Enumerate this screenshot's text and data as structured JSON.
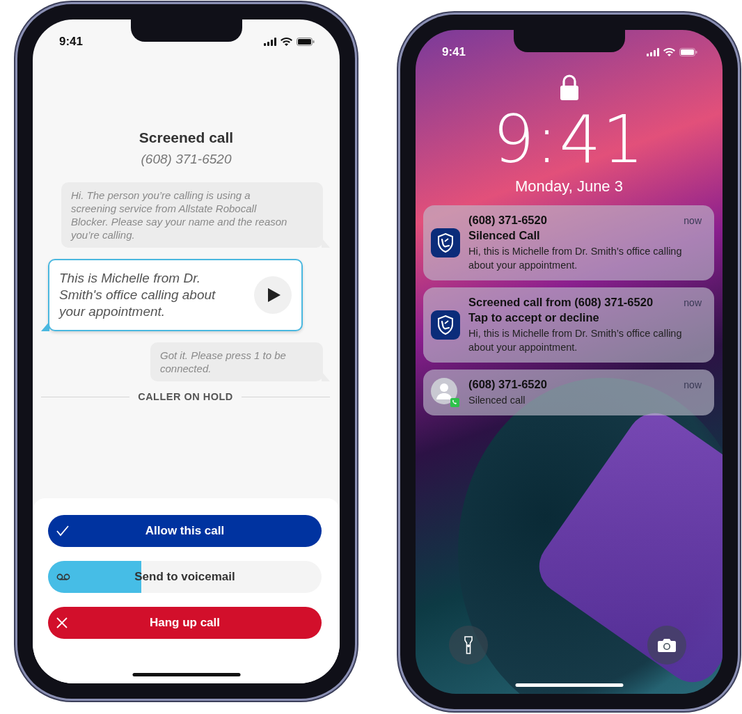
{
  "call_screen": {
    "status_bar": {
      "time": "9:41"
    },
    "title": "Screened call",
    "number": "(608) 371-6520",
    "messages": [
      {
        "kind": "prompt",
        "text": "Hi. The person you’re calling is using a screening service from Allstate Robocall Blocker. Please say your name and the reason you’re calling."
      },
      {
        "kind": "caller",
        "text": "This is Michelle from Dr. Smith's office calling about your appointment."
      },
      {
        "kind": "prompt",
        "text": "Got it. Please press 1 to be connected."
      }
    ],
    "hold_label": "CALLER ON HOLD",
    "actions": [
      {
        "kind": "allow",
        "label": "Allow this call"
      },
      {
        "kind": "voicemail",
        "label": "Send to voicemail",
        "level": 0.34
      },
      {
        "kind": "hangup",
        "label": "Hang up call"
      }
    ]
  },
  "lock_screen": {
    "status_bar": {
      "time": "9:41"
    },
    "clock": "9:41",
    "date": "Monday, June 3",
    "notifications": [
      {
        "kind": "app",
        "title": "(608) 371-6520",
        "subtitle": "Silenced Call",
        "body": "Hi, this is Michelle from Dr. Smith’s office calling about your appointment.",
        "time": "now"
      },
      {
        "kind": "app",
        "title": "Screened call from (608) 371-6520",
        "subtitle": "Tap to accept or decline",
        "body": "Hi, this is Michelle from Dr. Smith’s office calling about your appointment.",
        "time": "now"
      },
      {
        "kind": "contact",
        "title": "(608) 371-6520",
        "body": "Silenced call",
        "time": "now"
      }
    ]
  }
}
